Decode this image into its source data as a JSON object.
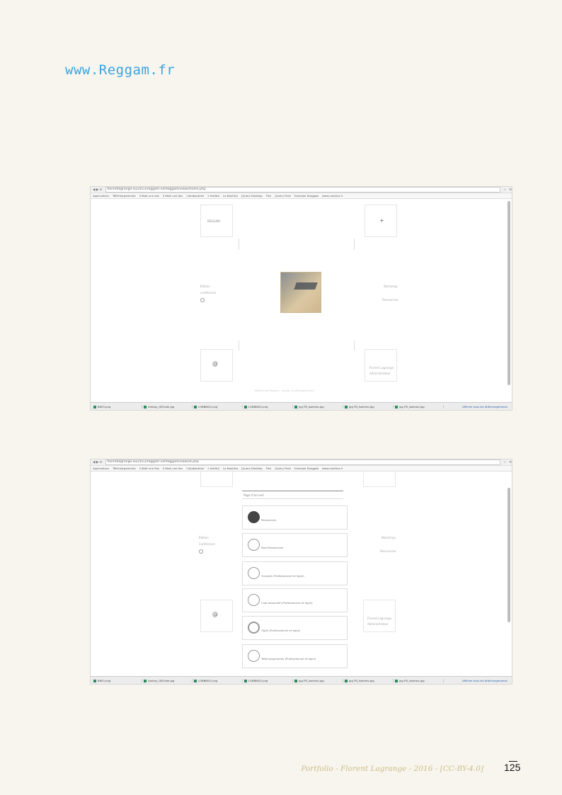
{
  "header": {
    "site": "www.Reggam.fr"
  },
  "screenshot1": {
    "url": "florentlagrange.eu/2013/reggam-v4/Reggam/views/home.php",
    "bookmarks": [
      "Applications",
      "Téléchargements",
      "Il était une fois",
      "Il était une fois",
      "Collaborative",
      "L'Institut",
      "La Nautilus",
      "jQuery Desktop",
      "Flex",
      "jQuery Pack",
      "Exemple Draggable",
      "www.nautilus.fr"
    ],
    "logo_text": "REGGAM",
    "plus": "+",
    "left_labels": [
      "Édition",
      "conférence"
    ],
    "right_labels": [
      "Workshop",
      "",
      "Ressources"
    ],
    "contact_labels": [
      "",
      "Florent Lagrange",
      "Administrateur"
    ],
    "footer_note": "Réalisé par Reggam - Design et développement",
    "downloads": [
      "B603.png",
      "Ambay_QRCode.jpg",
      "LOBBIN02.png",
      "LOBBIN02.png",
      "jpg FB_Isolemo.jpg",
      "jpg FB_Isolemo.jpg",
      "jpg FB_Isolemo.jpg"
    ],
    "show_all": "Afficher tous les téléchargements"
  },
  "screenshot2": {
    "url": "florentlagrange.eu/2013/reggam-v4/Reggam/views/4.php",
    "bookmarks": [
      "Applications",
      "Téléchargements",
      "Il était une fois",
      "Il était une fois",
      "Collaborative",
      "L'Institut",
      "La Nautilus",
      "jQuery Desktop",
      "Flex",
      "jQuery Pack",
      "Exemple Draggable",
      "www.nautilus.fr"
    ],
    "page_title": "Page d'accueil",
    "panels": [
      "Ressources",
      "Bord Ressources",
      "Groupes (Professionnel et ligne)",
      "Club associatif (Professionnel et ligne)",
      "Objet (Professionnel et ligne)",
      "Téléchargements (Professionnel et ligne)"
    ],
    "left_labels": [
      "Édition",
      "Conférence"
    ],
    "right_labels": [
      "Workshop",
      "",
      "Ressources"
    ],
    "contact_labels": [
      "",
      "Florent Lagrange",
      "Administrateur"
    ],
    "downloads": [
      "B603.png",
      "Ambay_QRCode.jpg",
      "LOBBIN02.png",
      "LOBBIN02.png",
      "jpg FB_Isolemo.jpg",
      "jpg FB_Isolemo.jpg",
      "jpg FB_Isolemo.jpg"
    ],
    "show_all": "Afficher tous les téléchargements"
  },
  "footer": {
    "credit": "Portfolio - Florent Lagrange - 2016 - [CC-BY-4.0]",
    "page_number": "125"
  }
}
